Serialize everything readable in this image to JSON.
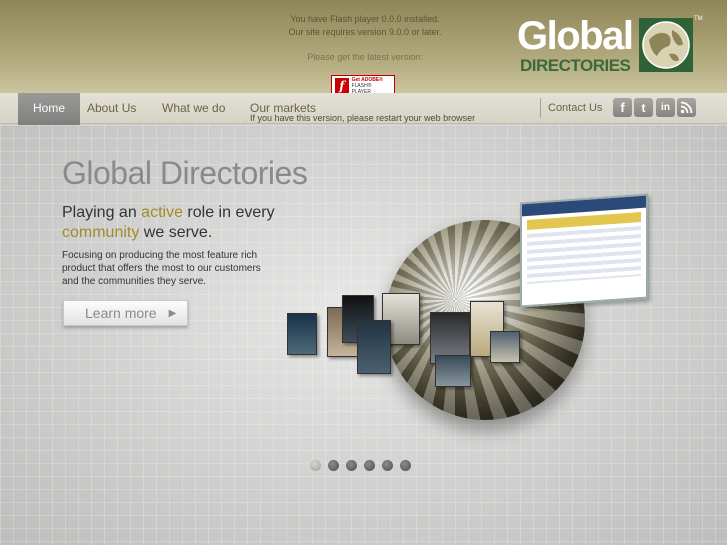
{
  "flash": {
    "line1": "You have Flash player 0.0.0 installed.",
    "line2": "Our site requires version 9.0.0 or later.",
    "line3": "Please get the latest version:",
    "badge_get": "Get ADOBE®",
    "badge_player": "FLASH® PLAYER",
    "restart": "If you have this version, please restart your web browser"
  },
  "logo": {
    "word": "Global",
    "sub": "DIRECTORIES",
    "tm": "TM"
  },
  "nav": {
    "home": "Home",
    "about": "About Us",
    "what": "What we do",
    "markets": "Our markets",
    "contact": "Contact Us"
  },
  "social": {
    "facebook": "f",
    "twitter": "t",
    "linkedin": "in",
    "rss": "rss"
  },
  "hero": {
    "title": "Global Directories",
    "tag_pre": "Playing an ",
    "tag_active": "active",
    "tag_mid": " role in every",
    "tag_community": "community",
    "tag_post": " we serve.",
    "desc": "Focusing on producing the most feature rich product that offers the most to our customers and the communities they serve.",
    "button": "Learn more",
    "button_arrow": "▶"
  },
  "carousel": {
    "slides": 6,
    "active_index": 0
  },
  "colors": {
    "header_gold": "#a59c6e",
    "accent_gold": "#a38a2c",
    "logo_green": "#2f6236"
  }
}
